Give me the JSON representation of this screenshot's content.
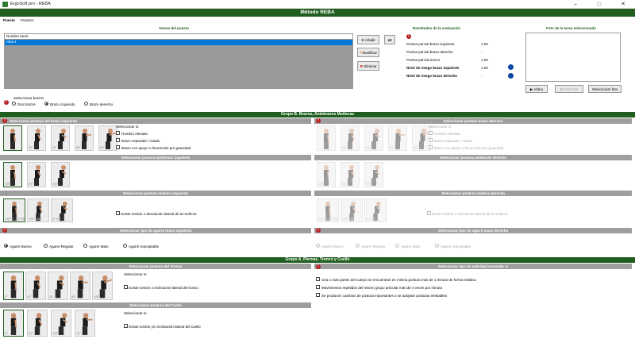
{
  "window": {
    "title": "ErgoSoft pro - REBA"
  },
  "banner": {
    "title": "Método REBA"
  },
  "puesto": {
    "label": "Puesto",
    "value": "Puesto1"
  },
  "tareas": {
    "title": "Tareas del puesto",
    "header": "Nombre tarea",
    "rows": [
      "reba 1"
    ],
    "add": "Añadir",
    "badge": "x2",
    "modify": "Modificar",
    "remove": "Eliminar"
  },
  "resultados": {
    "title": "Resultados de la evaluación",
    "rows": [
      {
        "label": "Puntos parcial brazo izquierdo",
        "value": "1.00"
      },
      {
        "label": "Puntos parcial brazo derecho",
        "value": "-"
      },
      {
        "label": "Puntos parcial tronco",
        "value": "1.00"
      },
      {
        "label": "Nivel de riesgo brazo izquierdo",
        "value": "1.00"
      },
      {
        "label": "Nivel de riesgo brazo derecho",
        "value": "-"
      }
    ]
  },
  "foto": {
    "title": "Foto de la tarea seleccionada",
    "video": "Video",
    "borrar": "Borrar Foto",
    "seleccionar": "Seleccionar foto"
  },
  "brazos": {
    "label": "Seleccionar brazos",
    "options": [
      "Dos brazos",
      "Brazo izquierdo",
      "Brazo derecho"
    ]
  },
  "grupoB": {
    "title": "Grupo B.  Brazos, Antebrazos Muñecas"
  },
  "brazoIzq": {
    "title": "Seleccionar postura del brazo izquierdo",
    "thumbs": [
      "",
      "20°",
      "20°",
      "45°",
      "90°"
    ],
    "selectLabel": "Seleccionar si:",
    "checks": [
      "Hombro elevado",
      "Brazo separado / rotado",
      "Brazo con apoyo o favorecido por gravedad"
    ]
  },
  "brazoDer": {
    "title": "Seleccionar postura brazo derecho",
    "selectLabel": "Seleccionar si:",
    "checks": [
      "Hombro elevado",
      "Brazo separado / rotado",
      "Brazo con apoyo o favorecido por gravedad"
    ]
  },
  "antebrazoIzq": {
    "title": "Seleccionar postura antebrazo izquierdo",
    "thumbs": [
      "100°",
      "60°",
      "100°"
    ]
  },
  "antebrazoDer": {
    "title": "Seleccionar postura antebrazo derecho",
    "thumbs": [
      "100°",
      "60°",
      "100°"
    ]
  },
  "munecaIzq": {
    "title": "Seleccionar postura muñeca izquierda",
    "thumbs": [
      "+15° 0° -15° Flexión",
      "+15° >15°",
      "0° >15°"
    ],
    "check": "Existe torsión o desviación lateral de la muñeca"
  },
  "munecaDer": {
    "title": "Seleccionar postura muñeca derecha",
    "thumbs": [
      "+15° 0° -15° Flexión",
      "+15° >15°",
      "0° >15°"
    ],
    "check": "Existe torsión o desviación lateral de la muñeca"
  },
  "agarreIzq": {
    "title": "Seleccionar tipo de agarre mano izquierda",
    "options": [
      "Agarre Bueno",
      "Agarre Regular",
      "Agarre Malo",
      "Agarre Inaceptable"
    ]
  },
  "agarreDer": {
    "title": "Seleccionar tipo de agarre mano derecha",
    "options": [
      "Agarre Bueno",
      "Agarre Regular",
      "Agarre Malo",
      "Agarre Inaceptable"
    ]
  },
  "grupoA": {
    "title": "Grupo A.  Piernas, Tronco y Cuello"
  },
  "tronco": {
    "title": "Seleccionar postura del Tronco",
    "thumbs": [
      "0°",
      "20°",
      "20°",
      "60°",
      ">60°"
    ],
    "selectLabel": "Seleccionar si:",
    "check": "Existe torsión o inclinación lateral del tronco"
  },
  "cuello": {
    "title": "Seleccionar postura del Cuello",
    "thumbs": [
      "0°",
      "20°",
      ">20°",
      "<0°"
    ],
    "selectLabel": "Seleccionar si:",
    "check": "Existe torsión y/o inclinación lateral del cuello"
  },
  "actividad": {
    "title": "Seleccionar tipo de actividad muscular si",
    "checks": [
      "Una o más partes del cuerpo se encuentran en misma postura más de 1 minuto de forma estática",
      "Movimientos repetidos del mismo grupo articular más de 4 veces por minuto",
      "Se producen cambios de postura importantes o se adoptan posturas inestables"
    ]
  },
  "colors": {
    "green": "#1f5e1f",
    "grey": "#9e9e9e",
    "warn": "#b71c1c",
    "blue": "#0d47a1"
  }
}
